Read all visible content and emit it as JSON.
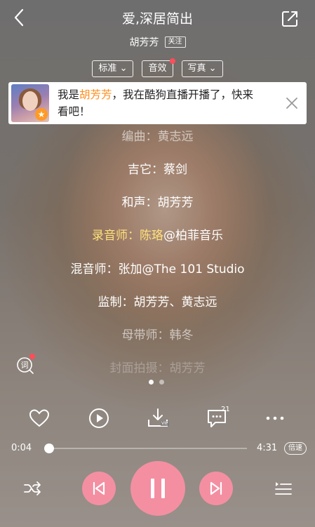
{
  "header": {
    "song_title": "爱,深居简出",
    "artist": "胡芳芳",
    "follow_label": "关注"
  },
  "pills": {
    "quality_label": "标准",
    "effect_label": "音效",
    "photo_label": "写真"
  },
  "banner": {
    "text_prefix": "我是",
    "highlight_name": "胡芳芳",
    "text_suffix": "，我在酷狗直播开播了，快来看吧！"
  },
  "lyrics": {
    "line0": "编曲：黄志远",
    "line1": "吉它：蔡剑",
    "line2": "和声：胡芳芳",
    "line3_sung": "录音师：陈珞",
    "line3_rest": "@柏菲音乐",
    "line4": "混音师：张加@The 101 Studio",
    "line5": "监制：胡芳芳、黄志远",
    "line6": "母带师：韩冬",
    "line7": "封面拍摄：胡芳芳"
  },
  "actions": {
    "comment_count": "21",
    "download_badge": "VIP"
  },
  "progress": {
    "current_time": "0:04",
    "total_time": "4:31",
    "fraction": 0.015,
    "speed_label": "倍速"
  },
  "colors": {
    "accent_pink": "#f48fa2",
    "highlight_yellow": "#ffe17a",
    "banner_orange": "#ff8c1a",
    "badge_red": "#ff4d5a"
  },
  "icons": {
    "back": "chevron-left-icon",
    "share": "share-icon",
    "lyric_mode": "lyric-icon",
    "like": "heart-icon",
    "video": "play-circle-icon",
    "download": "download-vip-icon",
    "comment": "comment-icon",
    "more": "more-icon",
    "play_mode": "shuffle-icon",
    "prev": "previous-icon",
    "pause": "pause-icon",
    "next": "next-icon",
    "queue": "queue-icon",
    "close": "close-icon"
  }
}
